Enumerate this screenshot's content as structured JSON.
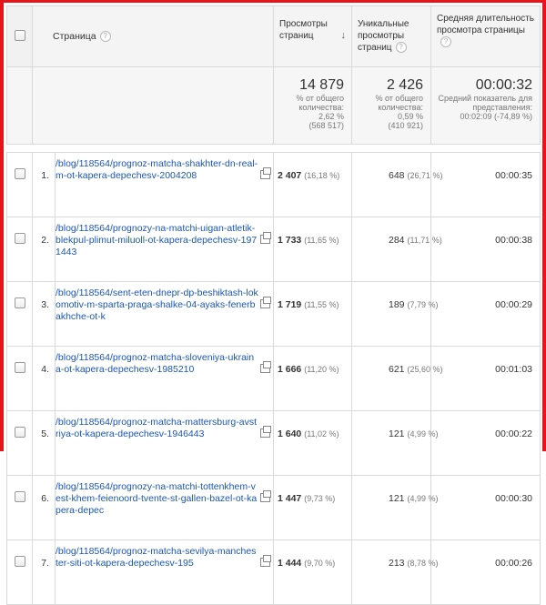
{
  "header": {
    "page_col": "Страница",
    "pageviews_col": "Просмотры страниц",
    "unique_col": "Уникальные просмотры страниц",
    "avgtime_col": "Средняя длительность просмотра страницы",
    "sort_arrow": "↓"
  },
  "summary": {
    "pageviews": {
      "value": "14 879",
      "label": "% от общего количества:",
      "pct": "2,62 %",
      "total": "(568 517)"
    },
    "unique": {
      "value": "2 426",
      "label": "% от общего количества:",
      "pct": "0,59 %",
      "total": "(410 921)"
    },
    "avgtime": {
      "value": "00:00:32",
      "label": "Средний показатель для представления:",
      "detail": "00:02:09 (-74,89 %)"
    }
  },
  "rows": [
    {
      "rank": "1.",
      "page": "/blog/118564/prognoz-matcha-shakhter-dn-real-m-ot-kapera-depechesv-2004208",
      "pageviews": "2 407",
      "pv_pct": "(16,18 %)",
      "unique": "648",
      "u_pct": "(26,71 %)",
      "time": "00:00:35"
    },
    {
      "rank": "2.",
      "page": "/blog/118564/prognozy-na-matchi-uigan-atletik-blekpul-plimut-miluoll-ot-kapera-depechesv-1971443",
      "pageviews": "1 733",
      "pv_pct": "(11,65 %)",
      "unique": "284",
      "u_pct": "(11,71 %)",
      "time": "00:00:38"
    },
    {
      "rank": "3.",
      "page": "/blog/118564/sent-eten-dnepr-dp-beshiktash-lokomotiv-m-sparta-praga-shalke-04-ayaks-fenerbakhche-ot-k",
      "pageviews": "1 719",
      "pv_pct": "(11,55 %)",
      "unique": "189",
      "u_pct": "(7,79 %)",
      "time": "00:00:29"
    },
    {
      "rank": "4.",
      "page": "/blog/118564/prognoz-matcha-sloveniya-ukraina-ot-kapera-depechesv-1985210",
      "pageviews": "1 666",
      "pv_pct": "(11,20 %)",
      "unique": "621",
      "u_pct": "(25,60 %)",
      "time": "00:01:03"
    },
    {
      "rank": "5.",
      "page": "/blog/118564/prognoz-matcha-mattersburg-avstriya-ot-kapera-depechesv-1946443",
      "pageviews": "1 640",
      "pv_pct": "(11,02 %)",
      "unique": "121",
      "u_pct": "(4,99 %)",
      "time": "00:00:22"
    },
    {
      "rank": "6.",
      "page": "/blog/118564/prognozy-na-matchi-tottenkhem-vest-khem-feienoord-tvente-st-gallen-bazel-ot-kapera-depec",
      "pageviews": "1 447",
      "pv_pct": "(9,73 %)",
      "unique": "121",
      "u_pct": "(4,99 %)",
      "time": "00:00:30"
    },
    {
      "rank": "7.",
      "page": "/blog/118564/prognoz-matcha-sevilya-manchester-siti-ot-kapera-depechesv-195",
      "pageviews": "1 444",
      "pv_pct": "(9,70 %)",
      "unique": "213",
      "u_pct": "(8,78 %)",
      "time": "00:00:26"
    }
  ],
  "colors": {
    "frame": "#e8141c",
    "link": "#1a56b5"
  }
}
